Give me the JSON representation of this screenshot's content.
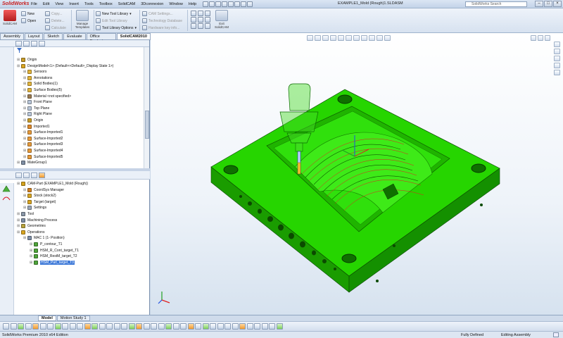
{
  "app": {
    "logo": "SolidWorks",
    "document_title": "EXAMPLE1_Mold (Rough)1.SLDASM",
    "search_placeholder": "SolidWorks Search",
    "menus": [
      "File",
      "Edit",
      "View",
      "Insert",
      "Tools",
      "Toolbox",
      "SolidCAM",
      "3Dconnexion",
      "Window",
      "Help"
    ]
  },
  "ribbon": {
    "solidcam_label": "SolidCAM",
    "new_label": "New",
    "open_label": "Open",
    "copy_label": "Copy...",
    "delete_label": "Delete...",
    "calculate_label": "Calculate",
    "manage_templates_label": "Manage Templates",
    "new_tool_library_label": "New Tool Library",
    "edit_tool_library_label": "Edit Tool Library",
    "tool_library_options_label": "Tool Library Options",
    "cam_settings_label": "CAM Settings...",
    "technology_database_label": "Technology Database",
    "hardware_key_label": "Hardware key info...",
    "exit_label": "Exit SolidCAM"
  },
  "tabs": [
    "Assembly",
    "Layout",
    "Sketch",
    "Evaluate",
    "Office Products",
    "SolidCAM2010"
  ],
  "tabs_active": "SolidCAM2010",
  "feature_tree": [
    {
      "label": "Origin",
      "icon": "origin-icon",
      "color": "#c79b2a",
      "indent": 0
    },
    {
      "label": "DesignModel<1> (Default<<Default>_Display State 1>)",
      "icon": "part-icon",
      "color": "#d9a521",
      "indent": 0
    },
    {
      "label": "Sensors",
      "icon": "sensor-icon",
      "color": "#e2b43c",
      "indent": 1
    },
    {
      "label": "Annotations",
      "icon": "annotation-icon",
      "color": "#e2b43c",
      "indent": 1
    },
    {
      "label": "Solid Bodies(1)",
      "icon": "solid-bodies-icon",
      "color": "#e2b43c",
      "indent": 1
    },
    {
      "label": "Surface Bodies(5)",
      "icon": "surface-bodies-icon",
      "color": "#e2b43c",
      "indent": 1
    },
    {
      "label": "Material <not specified>",
      "icon": "material-icon",
      "color": "#9a7b52",
      "indent": 1
    },
    {
      "label": "Front Plane",
      "icon": "plane-icon",
      "color": "#b9c6d8",
      "indent": 1
    },
    {
      "label": "Top Plane",
      "icon": "plane-icon",
      "color": "#b9c6d8",
      "indent": 1
    },
    {
      "label": "Right Plane",
      "icon": "plane-icon",
      "color": "#b9c6d8",
      "indent": 1
    },
    {
      "label": "Origin",
      "icon": "origin-icon",
      "color": "#c79b2a",
      "indent": 1
    },
    {
      "label": "Imported1",
      "icon": "imported-icon",
      "color": "#e08a2a",
      "indent": 1
    },
    {
      "label": "Surface-Imported1",
      "icon": "surface-icon",
      "color": "#e69a3a",
      "indent": 1
    },
    {
      "label": "Surface-Imported2",
      "icon": "surface-icon",
      "color": "#e69a3a",
      "indent": 1
    },
    {
      "label": "Surface-Imported3",
      "icon": "surface-icon",
      "color": "#e69a3a",
      "indent": 1
    },
    {
      "label": "Surface-Imported4",
      "icon": "surface-icon",
      "color": "#e69a3a",
      "indent": 1
    },
    {
      "label": "Surface-Imported5",
      "icon": "surface-icon",
      "color": "#e69a3a",
      "indent": 1
    },
    {
      "label": "MateGroup1",
      "icon": "mategroup-icon",
      "color": "#7f8ea3",
      "indent": 0
    }
  ],
  "cam_tree": [
    {
      "label": "CAM-Part (EXAMPLE1_Mold (Rough))",
      "icon": "cam-part-icon",
      "color": "#d5a21c",
      "indent": 0
    },
    {
      "label": "CoordSys Manager",
      "icon": "coordsys-icon",
      "color": "#d27f1e",
      "indent": 1
    },
    {
      "label": "Stock (stock2)",
      "icon": "stock-icon",
      "color": "#d9a521",
      "indent": 1
    },
    {
      "label": "Target (target)",
      "icon": "target-icon",
      "color": "#d9a521",
      "indent": 1
    },
    {
      "label": "Settings",
      "icon": "settings-icon",
      "color": "#9aa6b6",
      "indent": 1
    },
    {
      "label": "Tool",
      "icon": "tool-icon",
      "color": "#8a97a8",
      "indent": 0
    },
    {
      "label": "Machining Process",
      "icon": "machining-process-icon",
      "color": "#7c8ca3",
      "indent": 0
    },
    {
      "label": "Geometries",
      "icon": "geometries-icon",
      "color": "#b9a33c",
      "indent": 0
    },
    {
      "label": "Operations",
      "icon": "operations-icon",
      "color": "#d9a521",
      "indent": 0
    },
    {
      "label": "MAC 1 (1- Position)",
      "icon": "mac-icon",
      "color": "#7d8ea6",
      "indent": 1
    },
    {
      "label": "P_contour_T1",
      "icon": "operation-icon",
      "color": "#4fa43a",
      "indent": 2
    },
    {
      "label": "HSM_R_Cont_target_T1",
      "icon": "operation-icon",
      "color": "#4fa43a",
      "indent": 2
    },
    {
      "label": "HSM_RestM_target_T2",
      "icon": "operation-icon",
      "color": "#4fa43a",
      "indent": 2
    },
    {
      "label": "HSM_Parl_target_T3",
      "icon": "operation-icon",
      "color": "#4fa43a",
      "indent": 2,
      "selected": true
    }
  ],
  "bottom_tabs": [
    "Model",
    "Motion Study 1"
  ],
  "bottom_tab_active": "Model",
  "status": {
    "edition": "SolidWorks Premium 2010 x64 Edition",
    "defined": "Fully Defined",
    "mode": "Editing Assembly"
  },
  "colors": {
    "mold_green": "#26d500",
    "mold_dark": "#0f6f00",
    "ribbon_bg": "#dbe6f4",
    "selection": "#3c78d8"
  }
}
